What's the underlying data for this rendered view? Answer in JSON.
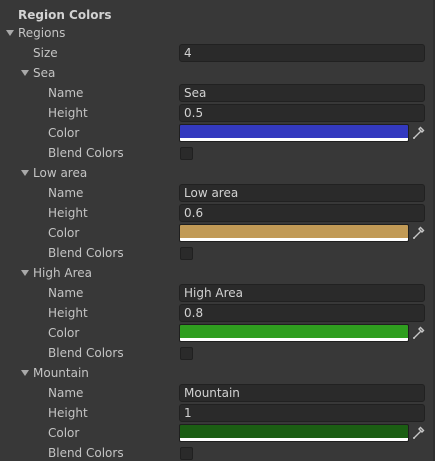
{
  "header": {
    "title": "Region Colors"
  },
  "regions": {
    "label": "Regions",
    "size_label": "Size",
    "size_value": "4",
    "field_labels": {
      "name": "Name",
      "height": "Height",
      "color": "Color",
      "blend": "Blend Colors"
    },
    "items": [
      {
        "title": "Sea",
        "name": "Sea",
        "height": "0.5",
        "color": "#3339bf",
        "blend": false
      },
      {
        "title": "Low area",
        "name": "Low area",
        "height": "0.6",
        "color": "#c19a56",
        "blend": false
      },
      {
        "title": "High Area",
        "name": "High Area",
        "height": "0.8",
        "color": "#2f9e1f",
        "blend": false
      },
      {
        "title": "Mountain",
        "name": "Mountain",
        "height": "1",
        "color": "#1b5e13",
        "blend": false
      }
    ]
  },
  "icons": {
    "foldout_arrow": "chevron-down-icon",
    "picker": "eyedropper-icon"
  }
}
